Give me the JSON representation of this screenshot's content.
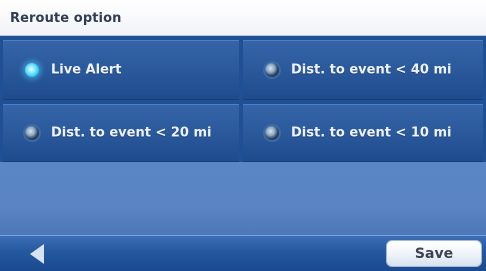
{
  "header": {
    "title": "Reroute option"
  },
  "options": [
    {
      "label": "Live Alert",
      "selected": true,
      "icon": "radio-selected-icon"
    },
    {
      "label": "Dist. to event < 40 mi",
      "selected": false,
      "icon": "radio-icon"
    },
    {
      "label": "Dist. to event < 20 mi",
      "selected": false,
      "icon": "radio-icon"
    },
    {
      "label": "Dist. to event < 10 mi",
      "selected": false,
      "icon": "radio-icon"
    }
  ],
  "footer": {
    "back_icon": "back-arrow-icon",
    "save_label": "Save"
  },
  "colors": {
    "background": "#5b86c5",
    "option_fill": "#2b5a9d",
    "selected_radio": "#25c2ef",
    "header_text": "#2f3c53"
  }
}
